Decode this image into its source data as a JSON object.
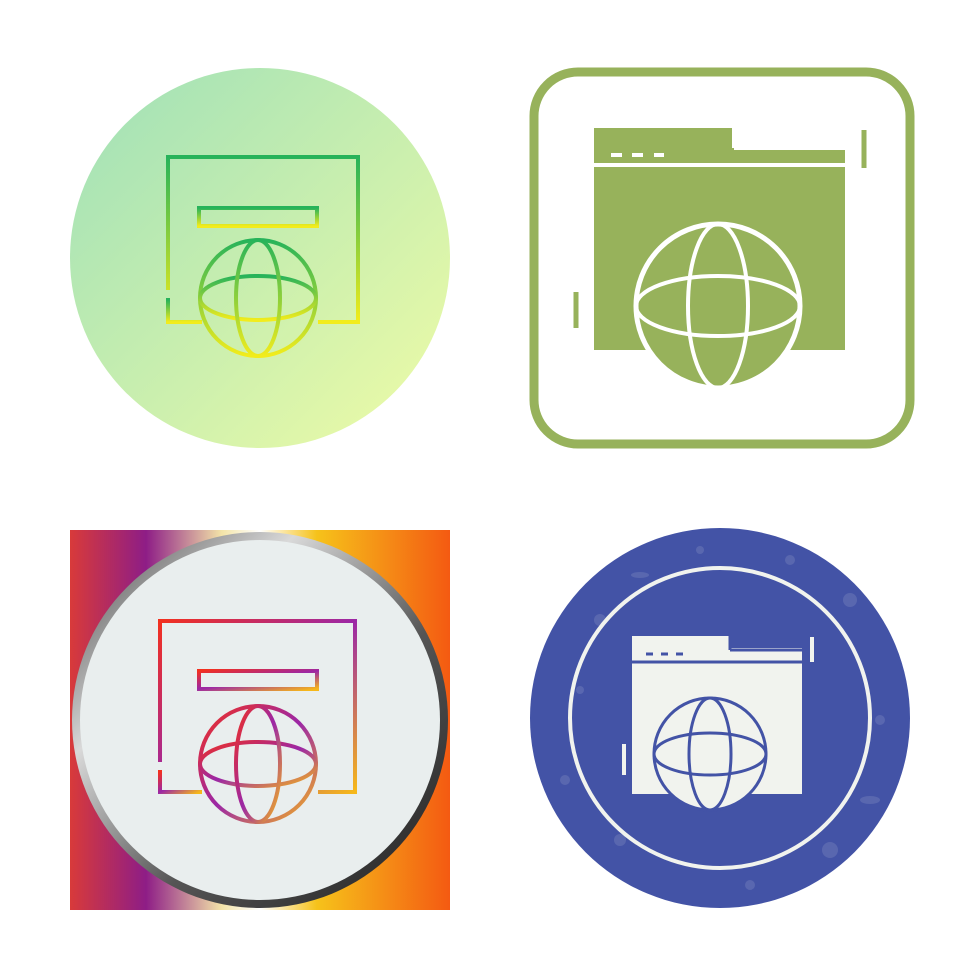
{
  "icons": [
    {
      "name": "web-browser-globe-icon",
      "style": "gradient-line",
      "badge": "circle",
      "badge_colors": [
        "#9ee0b8",
        "#f0fca6"
      ],
      "stroke_colors": [
        "#27b35a",
        "#f2ec1c"
      ]
    },
    {
      "name": "web-browser-globe-icon",
      "style": "glyph",
      "badge": "rounded-square-outline",
      "fill_color": "#97b25b",
      "detail_color": "#ffffff"
    },
    {
      "name": "web-browser-globe-icon",
      "style": "gradient-line",
      "badge": "square-with-circle",
      "badge_colors": [
        "#d83a3a",
        "#8e1d86",
        "#f6c21a",
        "#f45a12"
      ],
      "stroke_colors": [
        "#f2301f",
        "#9b27a6",
        "#f6b81a"
      ]
    },
    {
      "name": "web-browser-globe-icon",
      "style": "glyph",
      "badge": "grunge-circle",
      "badge_color": "#4353a6",
      "fill_color": "#f1f3ee"
    }
  ]
}
